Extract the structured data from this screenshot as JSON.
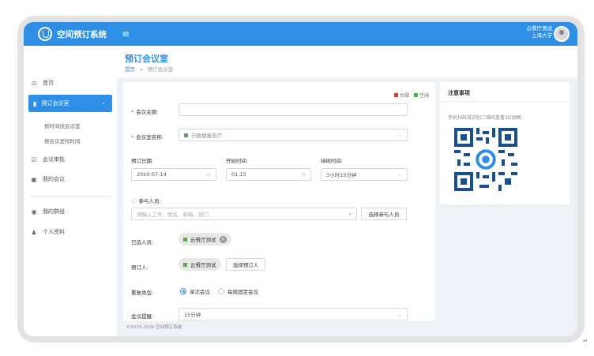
{
  "app": {
    "title": "空间预订系统",
    "user_line1": "云餐厅测试",
    "user_line2": "上海大学"
  },
  "sidebar": {
    "items": [
      {
        "label": "首页",
        "icon": "home-icon"
      },
      {
        "label": "预订会议室",
        "icon": "bookmark-icon",
        "active": true
      },
      {
        "label": "会议审批",
        "icon": "check-icon"
      },
      {
        "label": "我的会议",
        "icon": "calendar-icon"
      },
      {
        "label": "我的群组",
        "icon": "group-icon"
      },
      {
        "label": "个人资料",
        "icon": "user-icon"
      }
    ],
    "subitems": [
      "按时间找会议室",
      "按会议室找时间"
    ]
  },
  "header": {
    "title": "预订会议室",
    "breadcrumb_home": "首页",
    "breadcrumb_sep": ">",
    "breadcrumb_current": "预订会议室"
  },
  "legend": {
    "busy": "忙碌",
    "free": "空闲",
    "busy_color": "#e53935",
    "free_color": "#4caf50"
  },
  "form": {
    "subject_label": "会议主题:",
    "room_label": "会议室名称:",
    "room_value": "行政楼报告厅",
    "date_label": "预订日期:",
    "date_value": "2020-07-14",
    "start_label": "开始时间:",
    "start_value": "01:15",
    "duration_label": "持续时间:",
    "duration_value": "3小时15分钟",
    "participants_label": "参与人员:",
    "participants_placeholder": "请输入工号、姓名、邮箱、部门",
    "select_participants_btn": "选择参与人员",
    "selected_label": "已选人员:",
    "selected_person": "云餐厅测试",
    "booker_label": "预订人:",
    "booker_value": "云餐厅测试",
    "select_booker_btn": "选择预订人",
    "repeat_label": "重复类型:",
    "repeat_option1": "单次会议",
    "repeat_option2": "每周固定会议",
    "reminder_label": "会议提醒:",
    "reminder_value": "15分钟"
  },
  "notice": {
    "title": "注意事项",
    "text": "手机扫码或识别二维码查看3D动图:"
  },
  "footer": {
    "text": "©2015-2020 空间预订系统"
  }
}
